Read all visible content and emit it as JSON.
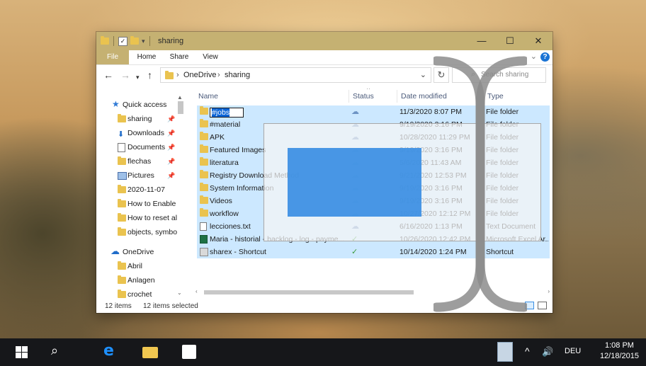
{
  "window": {
    "title": "sharing",
    "minimize": "—",
    "maximize": "☐",
    "close": "✕"
  },
  "ribbon": {
    "tabs": [
      "File",
      "Home",
      "Share",
      "View"
    ],
    "help": "?"
  },
  "address": {
    "crumbs": [
      "OneDrive",
      "sharing"
    ],
    "search_placeholder": "Search sharing"
  },
  "nav_pane": {
    "quick_access": "Quick access",
    "items": [
      "sharing",
      "Downloads",
      "Documents",
      "flechas",
      "Pictures",
      "2020-11-07",
      "How to Enable",
      "How to reset al",
      "objects, symbol"
    ],
    "onedrive": "OneDrive",
    "onedrive_items": [
      "Abril",
      "Anlagen",
      "crochet"
    ]
  },
  "columns": {
    "name": "Name",
    "status": "Status",
    "date": "Date modified",
    "type": "Type"
  },
  "files": [
    {
      "name": "#jobs",
      "date": "11/3/2020 8:07 PM",
      "type": "File folder",
      "icon": "folder-icon",
      "status": "cloud"
    },
    {
      "name": "#material",
      "date": "9/19/2020 3:16 PM",
      "type": "File folder",
      "icon": "folder-icon",
      "status": "cloud"
    },
    {
      "name": "APK",
      "date": "10/28/2020 11:29 PM",
      "type": "File folder",
      "icon": "folder-icon",
      "status": "cloud"
    },
    {
      "name": "Featured Images",
      "date": "9/19/2020 3:16 PM",
      "type": "File folder",
      "icon": "folder-icon",
      "status": "cloud"
    },
    {
      "name": "literatura",
      "date": "5/6/2020 11:43 AM",
      "type": "File folder",
      "icon": "folder-icon",
      "status": "cloud"
    },
    {
      "name": "Registry Download Method",
      "date": "9/21/2020 12:53 PM",
      "type": "File folder",
      "icon": "folder-icon",
      "status": "cloud"
    },
    {
      "name": "System Information",
      "date": "9/19/2020 3:16 PM",
      "type": "File folder",
      "icon": "folder-icon",
      "status": "cloud"
    },
    {
      "name": "Videos",
      "date": "9/19/2020 3:16 PM",
      "type": "File folder",
      "icon": "folder-icon",
      "status": "cloud"
    },
    {
      "name": "workflow",
      "date": "10/27/2020 12:12 PM",
      "type": "File folder",
      "icon": "folder-icon",
      "status": "cloud"
    },
    {
      "name": "lecciones.txt",
      "date": "6/16/2020 1:13 PM",
      "type": "Text Document",
      "icon": "text-file-icon",
      "status": "cloud"
    },
    {
      "name": "Maria - historial - backlog - log - payme...",
      "date": "10/26/2020 12:42 PM",
      "type": "Microsoft Excel Ar...",
      "icon": "excel-file-icon",
      "status": "synced"
    },
    {
      "name": "sharex - Shortcut",
      "date": "10/14/2020 1:24 PM",
      "type": "Shortcut",
      "icon": "shortcut-icon",
      "status": "synced"
    }
  ],
  "status_bar": {
    "count": "12 items",
    "selected": "12 items selected"
  },
  "taskbar": {
    "lang": "DEU",
    "time": "1:08 PM",
    "date": "12/18/2015"
  },
  "colors": {
    "titlebar": "#c5b172",
    "selection": "#cce8ff",
    "accent": "#0a64d6"
  }
}
